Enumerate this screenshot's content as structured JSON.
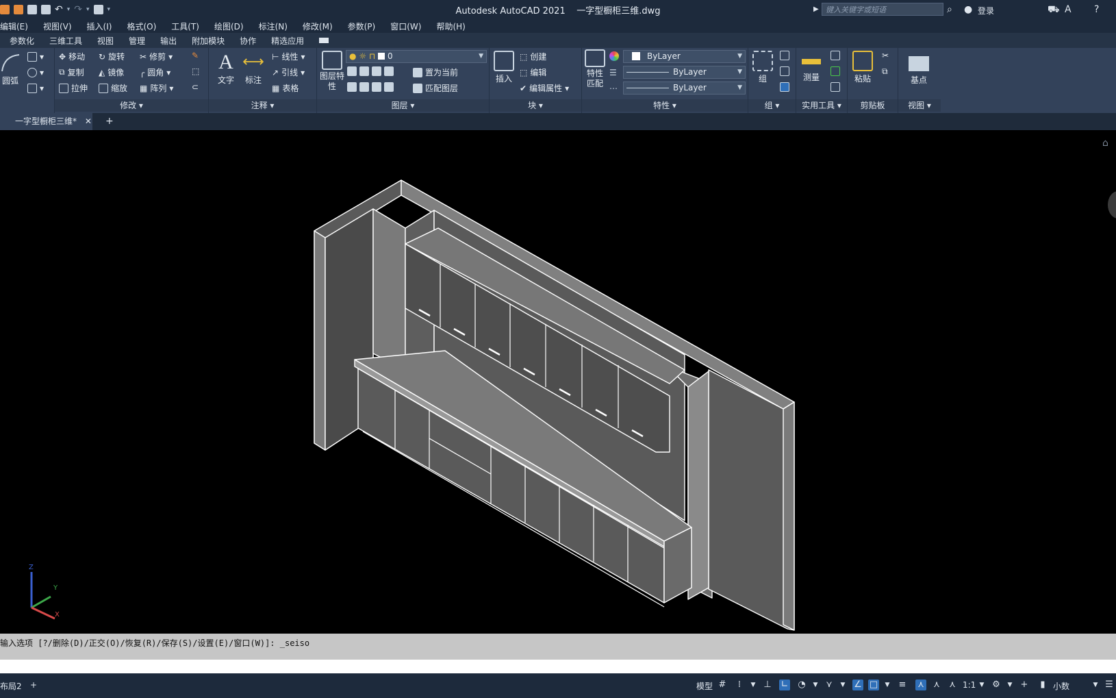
{
  "titlebar": {
    "app": "Autodesk AutoCAD 2021",
    "file": "一字型橱柜三维.dwg",
    "search_placeholder": "键入关键字或短语",
    "login": "登录"
  },
  "menu": [
    "编辑(E)",
    "视图(V)",
    "插入(I)",
    "格式(O)",
    "工具(T)",
    "绘图(D)",
    "标注(N)",
    "修改(M)",
    "参数(P)",
    "窗口(W)",
    "帮助(H)"
  ],
  "ribbon_tabs": [
    "参数化",
    "三维工具",
    "视图",
    "管理",
    "输出",
    "附加模块",
    "协作",
    "精选应用"
  ],
  "ribbon": {
    "draw": {
      "arc": "圆弧"
    },
    "modify": {
      "label": "修改",
      "move": "移动",
      "rotate": "旋转",
      "trim": "修剪",
      "copy": "复制",
      "mirror": "镜像",
      "fillet": "圆角",
      "stretch": "拉伸",
      "scale": "缩放",
      "array": "阵列"
    },
    "annotation": {
      "label": "注释",
      "text": "文字",
      "dimension": "标注",
      "linear": "线性",
      "leader": "引线",
      "table": "表格"
    },
    "layers": {
      "label": "图层",
      "properties": "图层特性",
      "current_layer": "0",
      "set_current": "置为当前",
      "match_layer": "匹配图层"
    },
    "block": {
      "label": "块",
      "insert": "插入",
      "create": "创建",
      "edit": "编辑",
      "edit_attr": "编辑属性"
    },
    "properties": {
      "label": "特性",
      "match": "特性匹配",
      "color": "ByLayer",
      "linetype": "ByLayer",
      "lineweight": "ByLayer"
    },
    "groups": {
      "label": "组",
      "group": "组"
    },
    "utilities": {
      "label": "实用工具",
      "measure": "测量"
    },
    "clipboard": {
      "label": "剪贴板",
      "paste": "粘贴"
    },
    "view": {
      "label": "视图",
      "base": "基点"
    }
  },
  "doc_tab": {
    "name": "一字型橱柜三维*"
  },
  "command": {
    "history": "输入选项 [?/删除(D)/正交(O)/恢复(R)/保存(S)/设置(E)/窗口(W)]: _seiso"
  },
  "status": {
    "layout": "布局2",
    "model": "模型",
    "scale": "1:1",
    "units": "小数"
  },
  "ucs": {
    "x": "X",
    "y": "Y",
    "z": "Z"
  }
}
